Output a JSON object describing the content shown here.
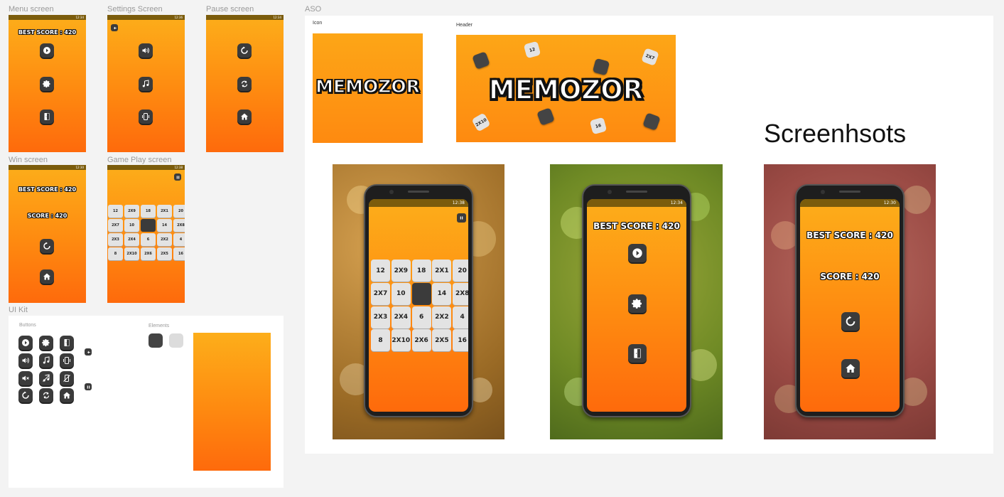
{
  "frames": {
    "menu": {
      "label": "Menu screen",
      "time": "12:34",
      "best_score": "BEST SCORE : 420",
      "buttons": [
        "play-icon",
        "gear-icon",
        "exit-door-icon"
      ]
    },
    "settings": {
      "label": "Settings Screen",
      "time": "12:36",
      "buttons": [
        "sound-icon",
        "music-icon",
        "vibration-icon"
      ]
    },
    "pause": {
      "label": "Pause screen",
      "time": "12:34",
      "buttons": [
        "resume-icon",
        "restart-icon",
        "home-icon"
      ]
    },
    "win": {
      "label": "Win screen",
      "time": "12:30",
      "best_score": "BEST SCORE : 420",
      "score": "SCORE : 420",
      "buttons": [
        "resume-icon",
        "home-icon"
      ]
    },
    "gameplay": {
      "label": "Game Play screen",
      "time": "12:38",
      "tiles": [
        "12",
        "2X9",
        "18",
        "2X1",
        "20",
        "2X7",
        "10",
        "",
        "14",
        "2X8",
        "2X3",
        "2X4",
        "6",
        "2X2",
        "4",
        "8",
        "2X10",
        "2X6",
        "2X5",
        "16"
      ]
    }
  },
  "uikit": {
    "label": "UI Kit",
    "buttons_label": "Buttons",
    "elements_label": "Elements",
    "icons": [
      "play-icon",
      "gear-icon",
      "exit-door-icon",
      "sound-icon",
      "music-icon",
      "vibration-icon",
      "mute-icon",
      "music-off-icon",
      "vibration-off-icon",
      "resume-icon",
      "restart-icon",
      "home-icon",
      "back-icon",
      "pause-icon"
    ]
  },
  "aso": {
    "label": "ASO",
    "icon_label": "Icon",
    "header_label": "Header",
    "logo_text": "MEMOZOR",
    "header_tiles": [
      "12",
      "2X7",
      "2X10",
      "16"
    ],
    "screenshots_title": "Screenhsots",
    "screenshots": [
      {
        "time": "12:38",
        "tiles": [
          "12",
          "2X9",
          "18",
          "2X1",
          "20",
          "2X7",
          "10",
          "",
          "14",
          "2X8",
          "2X3",
          "2X4",
          "6",
          "2X2",
          "4",
          "8",
          "2X10",
          "2X6",
          "2X5",
          "16"
        ]
      },
      {
        "time": "12:34",
        "best_score": "BEST SCORE : 420"
      },
      {
        "time": "12:30",
        "best_score": "BEST SCORE : 420",
        "score": "SCORE : 420"
      }
    ]
  },
  "colors": {
    "gradient_top": "#fdae1a",
    "gradient_bottom": "#fe6a0c",
    "button": "#3b3b3b",
    "tile": "#e3e3e3",
    "status_bar": "#7b5c0c"
  }
}
